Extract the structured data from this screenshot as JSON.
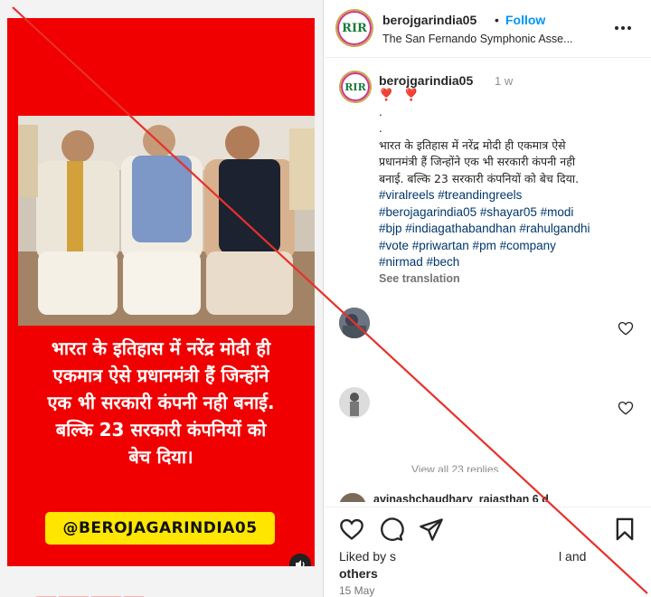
{
  "media": {
    "overlay_lines": [
      "भारत के इतिहास में नरेंद्र मोदी ही",
      "एकमात्र ऐसे प्रधानमंत्री हैं जिन्होंने",
      "एक भी सरकारी कंपनी नही बनाई.",
      "बल्कि 23 सरकारी कंपनियों को",
      "बेच दिया।"
    ],
    "handle_badge": "@BEROJAGARINDIA05",
    "volume_icon": "volume-icon"
  },
  "header": {
    "username": "berojgarindia05",
    "dot": "•",
    "follow_label": "Follow",
    "subtitle": "The San Fernando Symphonic Asse...",
    "avatar_text": "RIR"
  },
  "caption": {
    "username": "berojgarindia05",
    "time": "1 w",
    "hearts": "❣️ ❣️",
    "dots": [
      ".",
      "."
    ],
    "hindi_lines": [
      "भारत के इतिहास में नरेंद्र मोदी ही एकमात्र ऐसे",
      "प्रधानमंत्री हैं जिन्होंने एक भी सरकारी कंपनी नही",
      "बनाई. बल्कि 23 सरकारी कंपनियों को बेच दिया."
    ],
    "hashtag_lines": [
      "#viralreels #treandingreels",
      "#berojagarindia05 #shayar05 #modi",
      "#bjp #indiagathabandhan #rahulgandhi",
      "#vote #priwartan #pm #company",
      "#nirmad #bech"
    ],
    "see_translation": "See translation"
  },
  "comments": {
    "view_replies": "View all 23 replies",
    "partial_username": "avinashchaudhary_rajasthan 6 d"
  },
  "actions": {
    "liked_by_prefix": "Liked by s",
    "liked_by_suffix": "l and",
    "liked_by_others": "others",
    "date": "15 May"
  },
  "colors": {
    "reel_red": "#f00000",
    "badge_yellow": "#ffe600",
    "follow_blue": "#0095f6",
    "hashtag_blue": "#00376b",
    "strike_red": "#e8302a"
  }
}
